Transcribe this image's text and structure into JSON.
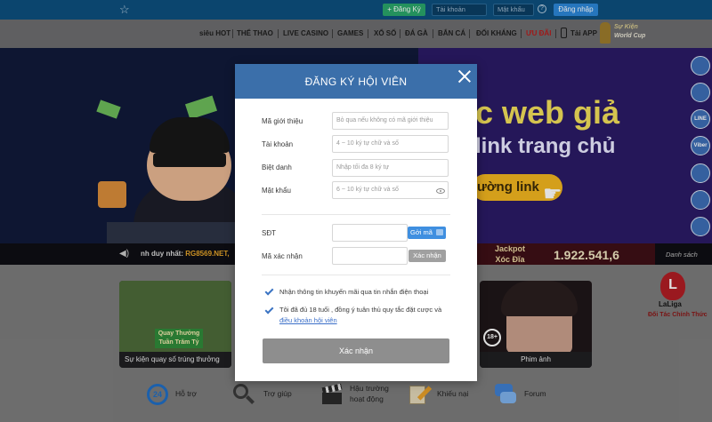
{
  "topbar": {
    "register_label": "+ Đăng Ký",
    "username_placeholder": "Tài khoản",
    "password_placeholder": "Mật khẩu",
    "help_icon": "?",
    "login_label": "Đăng nhập"
  },
  "nav": {
    "items": [
      "siêu HOT",
      "THỂ THAO",
      "LIVE CASINO",
      "GAMES",
      "XỔ SỐ",
      "ĐÁ GÀ",
      "BẮN CÁ",
      "ĐỐI KHÁNG",
      "ƯU ĐÃI",
      "Tải APP"
    ],
    "world_cup_line1": "Sự Kiện",
    "world_cup_line2": "World Cup"
  },
  "banner": {
    "promo_line1": "c web giả",
    "promo_line2": "link trang chủ",
    "promo_button": "ường link",
    "ticker_prefix": "nh duy nhất: ",
    "ticker_highlight": "RG8569.NET, ",
    "jackpot_line1": "Jackpot",
    "jackpot_line2": "Xóc Đĩa",
    "jackpot_value": "1.922.541,6",
    "list_link": "Danh sách"
  },
  "social": [
    "",
    "",
    "LINE",
    "Viber",
    "",
    "",
    ""
  ],
  "modal": {
    "title": "ĐĂNG KÝ HỘI VIÊN",
    "fields": {
      "referral": {
        "label": "Mã giới thiệu",
        "placeholder": "Bỏ qua nếu không có mã giới thiệu"
      },
      "account": {
        "label": "Tài khoản",
        "placeholder": "4 ~ 10 ký tự chữ và số"
      },
      "nickname": {
        "label": "Biệt danh",
        "placeholder": "Nhập tối đa 8 ký tự"
      },
      "password": {
        "label": "Mật khẩu",
        "placeholder": "6 ~ 10 ký tự chữ và số"
      },
      "phone": {
        "label": "SĐT",
        "button": "Gởi mã"
      },
      "code": {
        "label": "Mã xác nhận",
        "button": "Xác nhận"
      }
    },
    "consent_sms": "Nhận thông tin khuyến mãi qua tin nhắn điện thoại",
    "consent_age": "Tôi đã đủ 18 tuổi , đồng ý tuân thủ quy tắc đặt cược và",
    "terms_link": "điều khoản hội viên",
    "submit": "Xác nhận"
  },
  "lower": {
    "card_left_badge": "Quay Thưởng Tuần Trăm Tỷ",
    "card_left_caption": "Sự kiện quay số trúng thưởng",
    "card_right_caption": "Phim ảnh",
    "card_right_badge": "18+",
    "laliga_logo": "L",
    "laliga_name": "LaLiga",
    "laliga_sub": "Đối Tác Chính Thức",
    "services": [
      "Hỗ trợ",
      "Trợ giúp",
      "Hậu trường",
      "hoạt động",
      "Khiếu nại",
      "Forum"
    ],
    "icon_24": "24"
  }
}
